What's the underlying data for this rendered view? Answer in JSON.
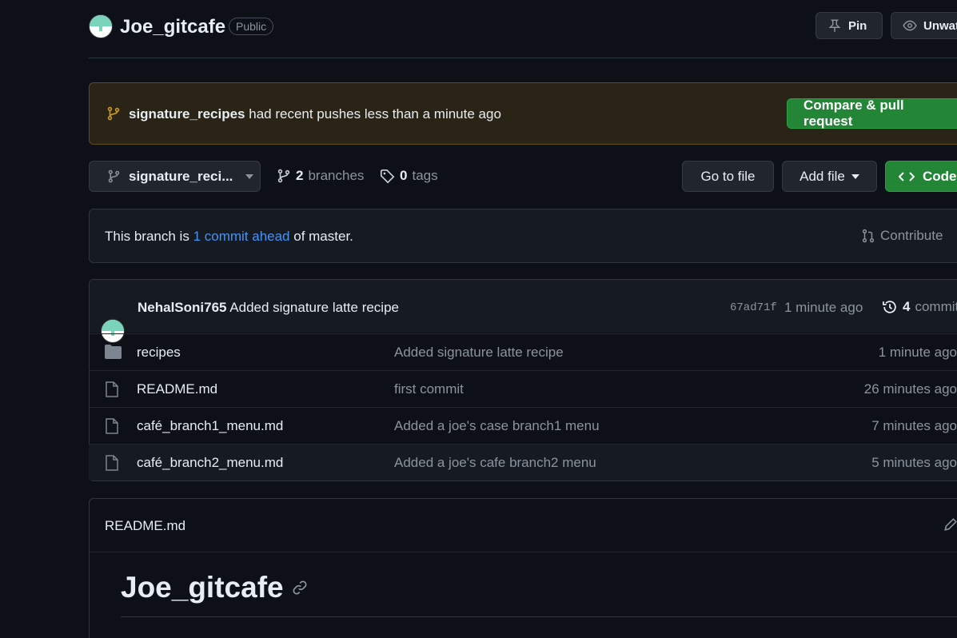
{
  "repo": {
    "name": "Joe_gitcafe",
    "visibility": "Public",
    "pin_label": "Pin",
    "watch_label": "Unwatch"
  },
  "banner": {
    "branch": "signature_recipes",
    "text": "had recent pushes less than a minute ago",
    "button": "Compare & pull request"
  },
  "toolbar": {
    "branch_selector": "signature_reci...",
    "branches_count": "2",
    "branches_label": "branches",
    "tags_count": "0",
    "tags_label": "tags",
    "go_to_file": "Go to file",
    "add_file": "Add file",
    "code": "Code"
  },
  "ahead": {
    "prefix": "This branch is",
    "link": "1 commit ahead",
    "suffix": "of master.",
    "contribute": "Contribute"
  },
  "commit": {
    "author": "NehalSoni765",
    "message": "Added signature latte recipe",
    "sha": "67ad71f",
    "time": "1 minute ago",
    "count": "4",
    "count_label": "commits"
  },
  "files": [
    {
      "type": "dir",
      "name": "recipes",
      "message": "Added signature latte recipe",
      "time": "1 minute ago"
    },
    {
      "type": "file",
      "name": "README.md",
      "message": "first commit",
      "time": "26 minutes ago"
    },
    {
      "type": "file",
      "name": "café_branch1_menu.md",
      "message": "Added a joe's case branch1 menu",
      "time": "7 minutes ago"
    },
    {
      "type": "file",
      "name": "café_branch2_menu.md",
      "message": "Added a joe's cafe branch2 menu",
      "time": "5 minutes ago"
    }
  ],
  "readme": {
    "filename": "README.md",
    "heading": "Joe_gitcafe"
  },
  "colors": {
    "background": "#0d1117",
    "accent_green": "#238636",
    "link_blue": "#4493f8",
    "banner_bg": "#2a2416"
  }
}
